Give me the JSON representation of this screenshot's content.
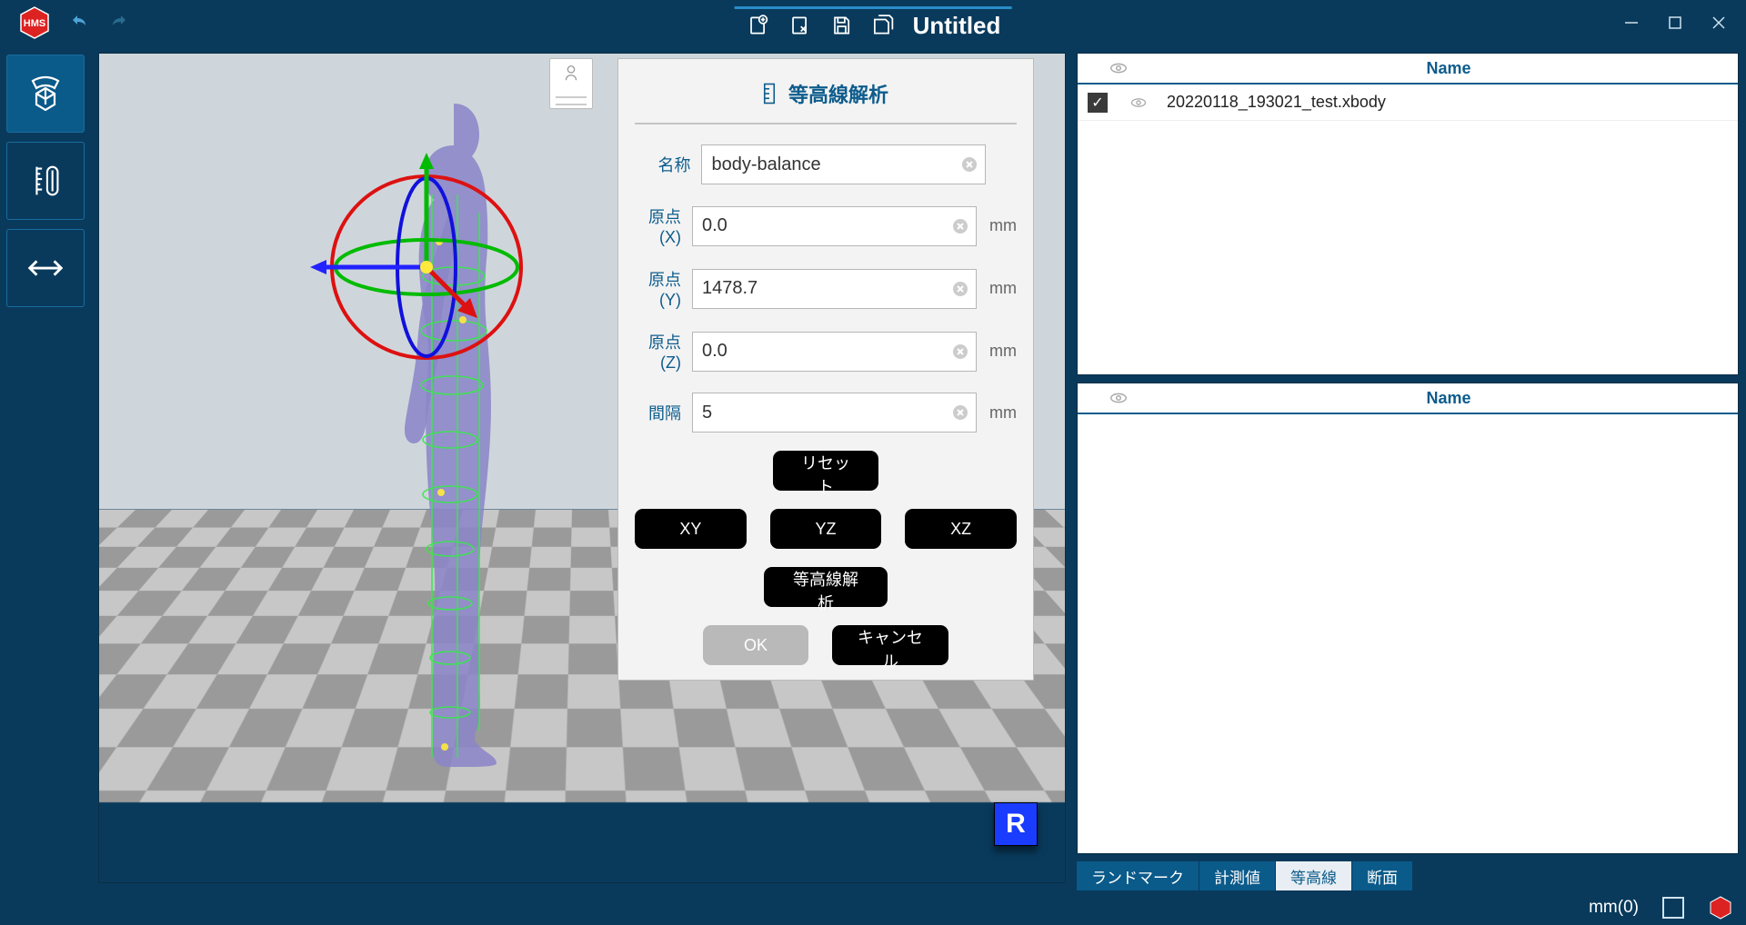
{
  "titlebar": {
    "title": "Untitled"
  },
  "dialog": {
    "title": "等高線解析",
    "labels": {
      "name": "名称",
      "x": "原点(X)",
      "y": "原点(Y)",
      "z": "原点(Z)",
      "interval": "間隔"
    },
    "values": {
      "name": "body-balance",
      "x": "0.0",
      "y": "1478.7",
      "z": "0.0",
      "interval": "5"
    },
    "unit": "mm",
    "buttons": {
      "reset": "リセット",
      "xy": "XY",
      "yz": "YZ",
      "xz": "XZ",
      "analyze": "等高線解析",
      "ok": "OK",
      "cancel": "キャンセル"
    }
  },
  "panel_top": {
    "header": "Name",
    "rows": [
      {
        "name": "20220118_193021_test.xbody",
        "checked": true
      }
    ]
  },
  "panel_bottom": {
    "header": "Name"
  },
  "tabs": [
    "ランドマーク",
    "計測値",
    "等高線",
    "断面"
  ],
  "tab_active_index": 2,
  "viewport": {
    "badge": "R"
  },
  "status": {
    "unit": "mm(0)"
  }
}
